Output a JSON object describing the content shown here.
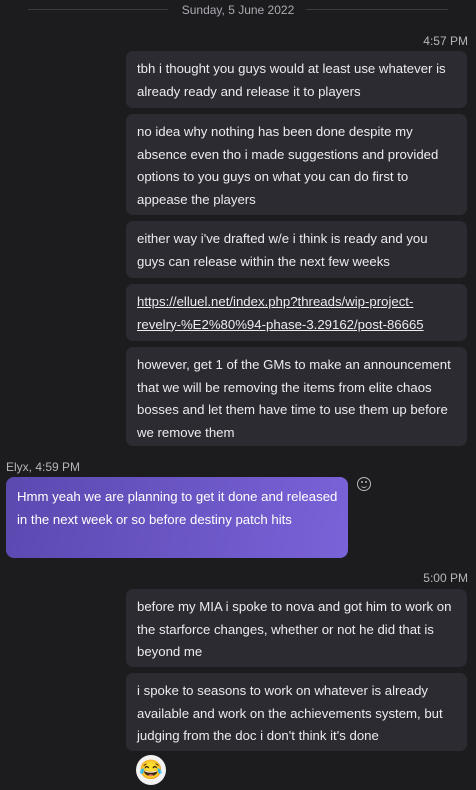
{
  "date_separator": "Sunday, 5 June 2022",
  "groups": [
    {
      "time": "4:57 PM",
      "messages": [
        "tbh i thought you guys would at least use whatever is already ready and release it to players",
        "no idea why nothing has been done despite my absence even tho i made suggestions and provided options to you guys on what you can do first to appease the players",
        "either way i've drafted w/e i think is ready and you guys can release within the next few weeks",
        "https://elluel.net/index.php?threads/wip-project-revelry-%E2%80%94-phase-3.29162/post-86665",
        "however, get 1 of the GMs to make an announcement that we will be removing the items from elite chaos bosses and let them have time to use them up before we remove them"
      ]
    },
    {
      "sender": "Elyx",
      "time": "4:59 PM",
      "messages": [
        "Hmm yeah we are planning to get it done and released in the next week or so before destiny patch hits"
      ]
    },
    {
      "time": "5:00 PM",
      "messages": [
        "before my MIA i spoke to nova and got him to work on the starforce changes, whether or not he did that is beyond me",
        "i spoke to seasons to work on whatever is already available and work on the achievements system, but judging from the doc i don't think it's done"
      ]
    }
  ],
  "incoming_sender_time": "Elyx, 4:59 PM",
  "reaction_emoji": "😂",
  "colors": {
    "background": "#1c1c1f",
    "outgoing_bubble": "#2b2b31",
    "incoming_gradient_start": "#5b49b0",
    "incoming_gradient_end": "#7a62d8"
  }
}
